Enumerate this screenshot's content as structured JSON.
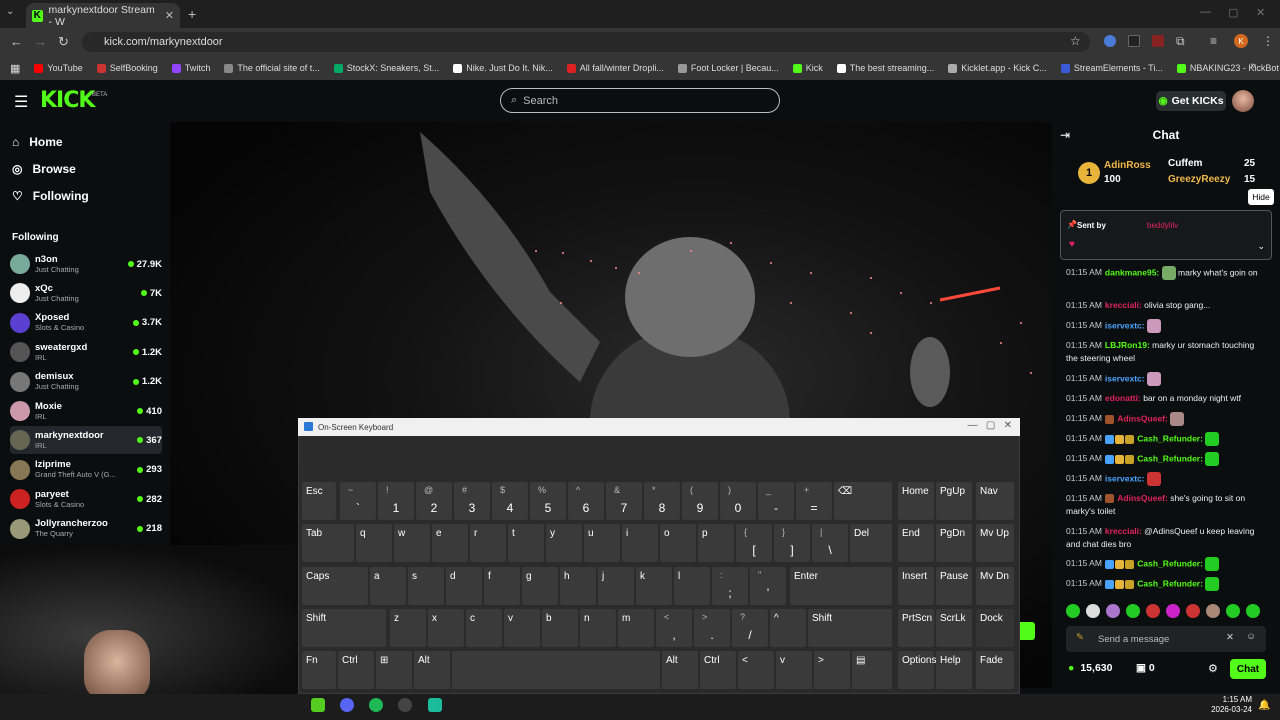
{
  "browser": {
    "tab_title": "markynextdoor Stream - W",
    "url": "kick.com/markynextdoor",
    "bookmarks": [
      {
        "label": "YouTube",
        "color": "#ff0000"
      },
      {
        "label": "SelfBooking",
        "color": "#c33"
      },
      {
        "label": "Twitch",
        "color": "#9146ff"
      },
      {
        "label": "The official site of t...",
        "color": "#888"
      },
      {
        "label": "StockX: Sneakers, St...",
        "color": "#0a6"
      },
      {
        "label": "Nike. Just Do It. Nik...",
        "color": "#fff"
      },
      {
        "label": "All fall/winter Dropli...",
        "color": "#d22"
      },
      {
        "label": "Foot Locker | Becau...",
        "color": "#999"
      },
      {
        "label": "Kick",
        "color": "#53fc18"
      },
      {
        "label": "The best streaming...",
        "color": "#fff"
      },
      {
        "label": "Kicklet.app - Kick C...",
        "color": "#aaa"
      },
      {
        "label": "StreamElements - Ti...",
        "color": "#3b5bdb"
      },
      {
        "label": "NBAKING23 - KickBot",
        "color": "#53fc18"
      },
      {
        "label": "Google",
        "color": "#4285f4"
      }
    ]
  },
  "header": {
    "search_placeholder": "Search",
    "get_kicks": "Get KICKs",
    "beta": "BETA"
  },
  "sidebar": {
    "nav": [
      {
        "label": "Home",
        "icon": "home-icon"
      },
      {
        "label": "Browse",
        "icon": "compass-icon"
      },
      {
        "label": "Following",
        "icon": "heart-icon"
      }
    ],
    "following_title": "Following",
    "channels": [
      {
        "name": "n3on",
        "category": "Just Chatting",
        "viewers": "27.9K",
        "color": "#7a9"
      },
      {
        "name": "xQc",
        "category": "Just Chatting",
        "viewers": "7K",
        "color": "#eee"
      },
      {
        "name": "Xposed",
        "category": "Slots & Casino",
        "viewers": "3.7K",
        "color": "#5a3fd0"
      },
      {
        "name": "sweatergxd",
        "category": "IRL",
        "viewers": "1.2K",
        "color": "#555"
      },
      {
        "name": "demisux",
        "category": "Just Chatting",
        "viewers": "1.2K",
        "color": "#777"
      },
      {
        "name": "Moxie",
        "category": "IRL",
        "viewers": "410",
        "color": "#c9a"
      },
      {
        "name": "markynextdoor",
        "category": "IRL",
        "viewers": "367",
        "color": "#665"
      },
      {
        "name": "lziprime",
        "category": "Grand Theft Auto V (G...",
        "viewers": "293",
        "color": "#875"
      },
      {
        "name": "paryeet",
        "category": "Slots & Casino",
        "viewers": "282",
        "color": "#c22"
      },
      {
        "name": "Jollyrancherzoo",
        "category": "The Quarry",
        "viewers": "218",
        "color": "#997"
      }
    ]
  },
  "chat": {
    "title": "Chat",
    "leaderboard": {
      "rank": "1",
      "first_name": "AdinRoss",
      "first_value": "100",
      "second_name": "Cuffem",
      "second_value": "25",
      "third_name": "GreezyReezy",
      "third_value": "15"
    },
    "hide_label": "Hide",
    "pinned": {
      "label": "Sent by",
      "user": "beddylilv"
    },
    "messages": [
      {
        "time": "01:15 AM",
        "user": "dankmane95:",
        "ucolor": "#53fc18",
        "text": "marky what's goin on",
        "emote": "#7a6"
      },
      {
        "time": "01:15 AM",
        "user": "krecciali:",
        "ucolor": "#e0245e",
        "text": "olivia stop gang..."
      },
      {
        "time": "01:15 AM",
        "user": "iservextc:",
        "ucolor": "#4aa3ff",
        "text": "",
        "emote": "#c9b"
      },
      {
        "time": "01:15 AM",
        "user": "LBJRon19:",
        "ucolor": "#53fc18",
        "text": "marky ur stomach touching the steering wheel"
      },
      {
        "time": "01:15 AM",
        "user": "iservextc:",
        "ucolor": "#4aa3ff",
        "text": "",
        "emote": "#c9b"
      },
      {
        "time": "01:15 AM",
        "user": "edonatti:",
        "ucolor": "#e0245e",
        "text": "bar on a monday night wtf"
      },
      {
        "time": "01:15 AM",
        "user": "AdinsQueef:",
        "ucolor": "#e0245e",
        "text": "",
        "emote": "#a88"
      },
      {
        "time": "01:15 AM",
        "user": "Cash_Refunder:",
        "ucolor": "#53fc18",
        "text": "",
        "emote": "#2c2"
      },
      {
        "time": "01:15 AM",
        "user": "Cash_Refunder:",
        "ucolor": "#53fc18",
        "text": "",
        "emote": "#2c2"
      },
      {
        "time": "01:15 AM",
        "user": "iservextc:",
        "ucolor": "#4aa3ff",
        "text": "",
        "emote": "#c33"
      },
      {
        "time": "01:15 AM",
        "user": "AdinsQueef:",
        "ucolor": "#e0245e",
        "text": "she's going to sit on marky's toilet"
      },
      {
        "time": "01:15 AM",
        "user": "krecciali:",
        "ucolor": "#e0245e",
        "text": "@AdinsQueef u keep leaving and chat dies bro"
      },
      {
        "time": "01:15 AM",
        "user": "Cash_Refunder:",
        "ucolor": "#53fc18",
        "text": "",
        "emote": "#2c2"
      },
      {
        "time": "01:15 AM",
        "user": "Cash_Refunder:",
        "ucolor": "#53fc18",
        "text": "",
        "emote": "#2c2"
      }
    ],
    "send_placeholder": "Send a message",
    "points": "15,630",
    "kicks": "0",
    "chat_button": "Chat"
  },
  "osk": {
    "title": "On-Screen Keyboard"
  },
  "taskbar": {
    "time": "1:15 AM",
    "date": "2026-03-24"
  }
}
